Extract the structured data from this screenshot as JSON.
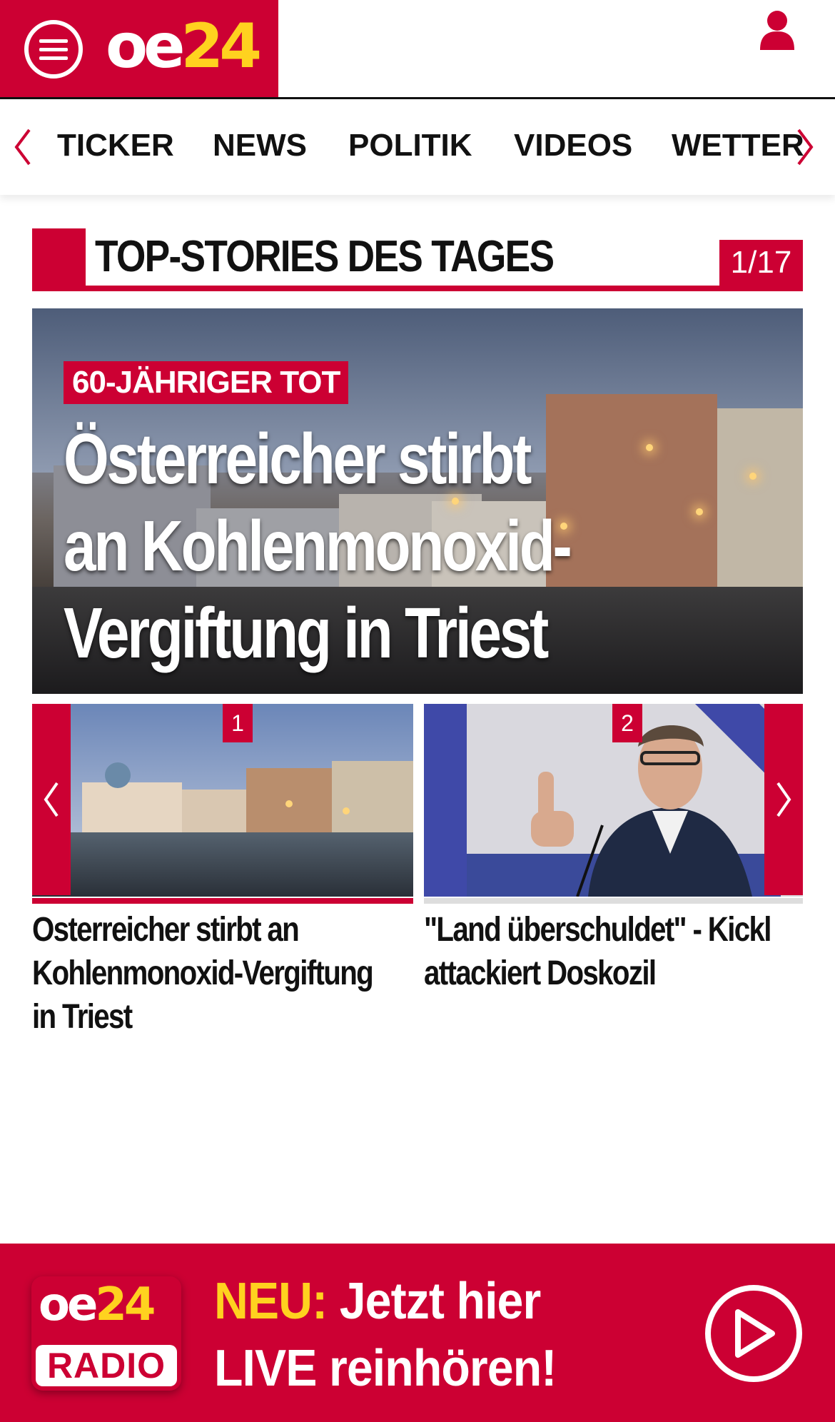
{
  "header": {
    "logo_oe": "oe",
    "logo_num": "24",
    "brand_color": "#cc0033",
    "accent_color": "#ffd21f"
  },
  "nav": {
    "items": [
      {
        "label": "TICKER"
      },
      {
        "label": "NEWS"
      },
      {
        "label": "POLITIK"
      },
      {
        "label": "VIDEOS"
      },
      {
        "label": "WETTER"
      }
    ],
    "left_icon": "chevron-left-icon",
    "right_icon": "chevron-right-icon"
  },
  "section": {
    "title": "TOP-STORIES DES TAGES",
    "counter": "1/17"
  },
  "hero": {
    "kicker": "60-JÄHRIGER TOT",
    "headline_lines": [
      "Österreicher stirbt",
      "an Kohlenmonoxid-",
      "Vergiftung in Triest"
    ]
  },
  "cards": [
    {
      "number": "1",
      "title_lines": [
        "Osterreicher stirbt an",
        "Kohlenmonoxid-Vergiftung",
        "in Triest"
      ]
    },
    {
      "number": "2",
      "title_lines": [
        "\"Land überschuldet\" - Kickl",
        "attackiert Doskozil"
      ]
    }
  ],
  "radio": {
    "logo_oe": "oe",
    "logo_num": "24",
    "logo_label": "RADIO",
    "neu": "NEU:",
    "line1_rest": " Jetzt hier",
    "line2": "LIVE reinhören!"
  }
}
